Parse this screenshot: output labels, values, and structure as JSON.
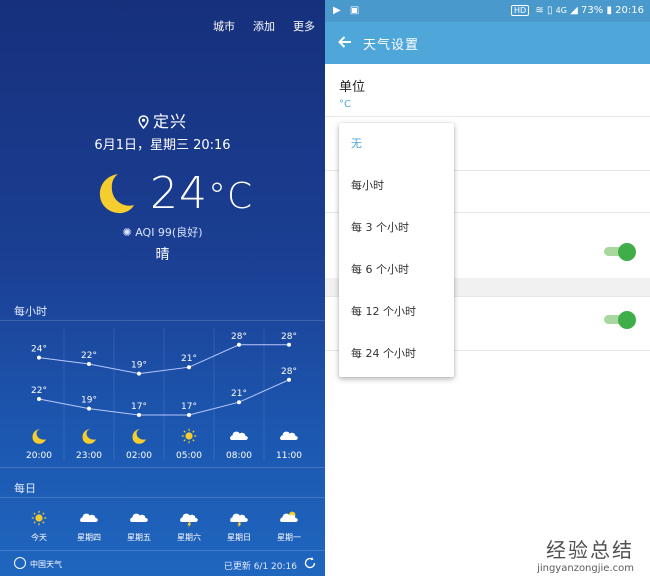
{
  "weather": {
    "menu": [
      "城市",
      "添加",
      "更多"
    ],
    "city": "定兴",
    "datetime": "6月1日，星期三 20:16",
    "temperature": "24",
    "temp_unit": "°C",
    "aqi": "AQI 99(良好)",
    "condition": "晴",
    "hourly_label": "每小时",
    "daily_label": "每日",
    "hourly": [
      {
        "time": "20:00",
        "high": "24°",
        "low": "22°",
        "icon": "moon-icon",
        "high_val": 24,
        "low_val": 22
      },
      {
        "time": "23:00",
        "high": "22°",
        "low": "19°",
        "icon": "moon-icon",
        "high_val": 22,
        "low_val": 19
      },
      {
        "time": "02:00",
        "high": "19°",
        "low": "17°",
        "icon": "moon-icon",
        "high_val": 19,
        "low_val": 17
      },
      {
        "time": "05:00",
        "high": "21°",
        "low": "17°",
        "icon": "sun-icon",
        "high_val": 21,
        "low_val": 17
      },
      {
        "time": "08:00",
        "high": "28°",
        "low": "21°",
        "icon": "cloud-icon",
        "high_val": 28,
        "low_val": 21
      },
      {
        "time": "11:00",
        "high": "28°",
        "low": "28°",
        "icon": "cloud-icon",
        "high_val": 28,
        "low_val": 28
      }
    ],
    "daily": [
      {
        "day": "今天",
        "icon": "sun-icon"
      },
      {
        "day": "星期四",
        "icon": "cloud-icon"
      },
      {
        "day": "星期五",
        "icon": "cloud-icon"
      },
      {
        "day": "星期六",
        "icon": "thunder-cloud-icon"
      },
      {
        "day": "星期日",
        "icon": "thunder-cloud-icon"
      },
      {
        "day": "星期一",
        "icon": "sun-cloud-icon"
      }
    ],
    "footer_brand": "中国天气",
    "footer_updated": "已更新 6/1  20:16"
  },
  "status_bar": {
    "hd": "HD",
    "network": "4G",
    "battery": "73%",
    "time": "20:16"
  },
  "settings": {
    "title": "天气设置",
    "unit_label": "单位",
    "unit_value": "°C",
    "dropdown_options": [
      "无",
      "每小时",
      "每 3 个小时",
      "每 6 个小时",
      "每 12 个小时",
      "每 24 个小时"
    ],
    "selected_option": "无"
  },
  "watermark": {
    "title": "经验总结",
    "url": "jingyanzongjie.com"
  },
  "colors": {
    "accent": "#4ea6d9",
    "toggle_on": "#3fae49",
    "panel_top": "#16307c",
    "panel_bottom": "#1f66bf"
  }
}
